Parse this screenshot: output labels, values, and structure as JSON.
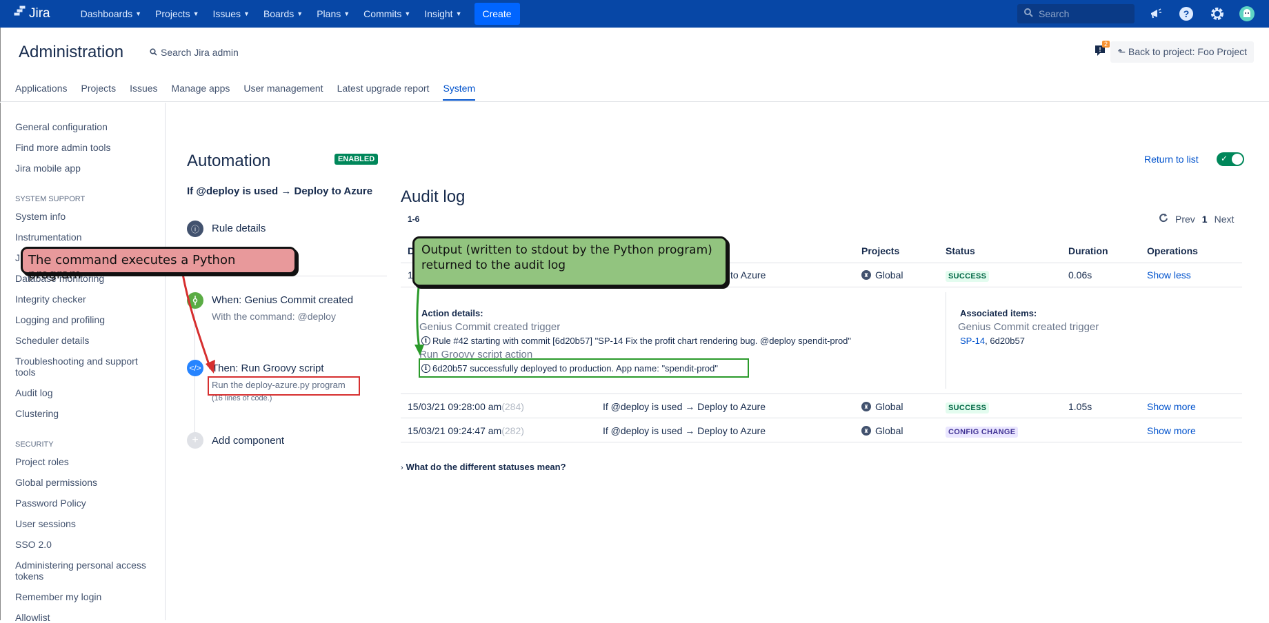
{
  "topnav": {
    "logo_text": "Jira",
    "items": [
      {
        "label": "Dashboards"
      },
      {
        "label": "Projects"
      },
      {
        "label": "Issues"
      },
      {
        "label": "Boards"
      },
      {
        "label": "Plans"
      },
      {
        "label": "Commits"
      },
      {
        "label": "Insight"
      }
    ],
    "create_label": "Create",
    "search_placeholder": "Search",
    "icons": [
      "megaphone-icon",
      "help-icon",
      "settings-icon",
      "avatar"
    ]
  },
  "admin": {
    "title": "Administration",
    "search_label": "Search Jira admin",
    "feedback_count": "2",
    "back_label": "Back to project: Foo Project",
    "tabs": [
      {
        "label": "Applications"
      },
      {
        "label": "Projects"
      },
      {
        "label": "Issues"
      },
      {
        "label": "Manage apps"
      },
      {
        "label": "User management"
      },
      {
        "label": "Latest upgrade report"
      },
      {
        "label": "System",
        "active": true
      }
    ]
  },
  "sidebar": {
    "items": [
      {
        "label": "General configuration"
      },
      {
        "label": "Find more admin tools"
      },
      {
        "label": "Jira mobile app"
      }
    ],
    "section_support": "SYSTEM SUPPORT",
    "support_items": [
      {
        "label": "System info"
      },
      {
        "label": "Instrumentation"
      },
      {
        "label": "J"
      },
      {
        "label": "Database monitoring"
      },
      {
        "label": "Integrity checker"
      },
      {
        "label": "Logging and profiling"
      },
      {
        "label": "Scheduler details"
      },
      {
        "label": "Troubleshooting and support tools"
      },
      {
        "label": "Audit log"
      },
      {
        "label": "Clustering"
      }
    ],
    "section_security": "SECURITY",
    "security_items": [
      {
        "label": "Project roles"
      },
      {
        "label": "Global permissions"
      },
      {
        "label": "Password Policy"
      },
      {
        "label": "User sessions"
      },
      {
        "label": "SSO 2.0"
      },
      {
        "label": "Administering personal access tokens"
      },
      {
        "label": "Remember my login"
      },
      {
        "label": "Allowlist"
      }
    ]
  },
  "automation": {
    "title": "Automation",
    "status_badge": "ENABLED",
    "rule_name": "If @deploy is used → Deploy to Azure",
    "return_label": "Return to list",
    "rule_enabled": true,
    "steps": {
      "details": "Rule details",
      "when_title": "When: Genius Commit created",
      "when_sub": "With the command: @deploy",
      "then_title": "Then: Run Groovy script",
      "then_sub": "Run the deploy-azure.py program",
      "then_note": "(16 lines of code.)",
      "add": "Add component"
    }
  },
  "audit": {
    "title": "Audit log",
    "range": "1-6",
    "pager": {
      "prev": "Prev",
      "page": "1",
      "next": "Next"
    },
    "columns": {
      "date": "D",
      "projects": "Projects",
      "status": "Status",
      "duration": "Duration",
      "operations": "Operations"
    },
    "rows": [
      {
        "date": "1",
        "id": "",
        "rule": "to Azure",
        "project": "Global",
        "status": "SUCCESS",
        "duration": "0.06s",
        "op": "Show less"
      },
      {
        "date": "15/03/21 09:28:00 am",
        "id": "(284)",
        "rule": "If @deploy is used → Deploy to Azure",
        "project": "Global",
        "status": "SUCCESS",
        "duration": "1.05s",
        "op": "Show more"
      },
      {
        "date": "15/03/21 09:24:47 am",
        "id": "(282)",
        "rule": "If @deploy is used → Deploy to Azure",
        "project": "Global",
        "status": "CONFIG CHANGE",
        "duration": "",
        "op": "Show more"
      }
    ],
    "details": {
      "action_label": "Action details:",
      "trigger": "Genius Commit created trigger",
      "trigger_msg": "Rule #42 starting with commit [6d20b57] \"SP-14 Fix the profit chart rendering bug. @deploy spendit-prod\"",
      "action": "Run Groovy script action",
      "action_msg": "6d20b57 successfully deployed to production. App name: \"spendit-prod\"",
      "assoc_label": "Associated items:",
      "assoc_trigger": "Genius Commit created trigger",
      "assoc_issue": "SP-14",
      "assoc_commit": ", 6d20b57"
    },
    "statuses_question": "What do the different statuses mean?"
  },
  "annotations": {
    "red_callout": "The command executes a Python program",
    "green_callout": "Output (written to stdout by the Python program) returned to the audit log"
  },
  "colors": {
    "nav": "#0747a6",
    "link": "#0052cc",
    "success": "#00875a",
    "red_callout": "#e8999b",
    "green_callout": "#92c47f"
  }
}
